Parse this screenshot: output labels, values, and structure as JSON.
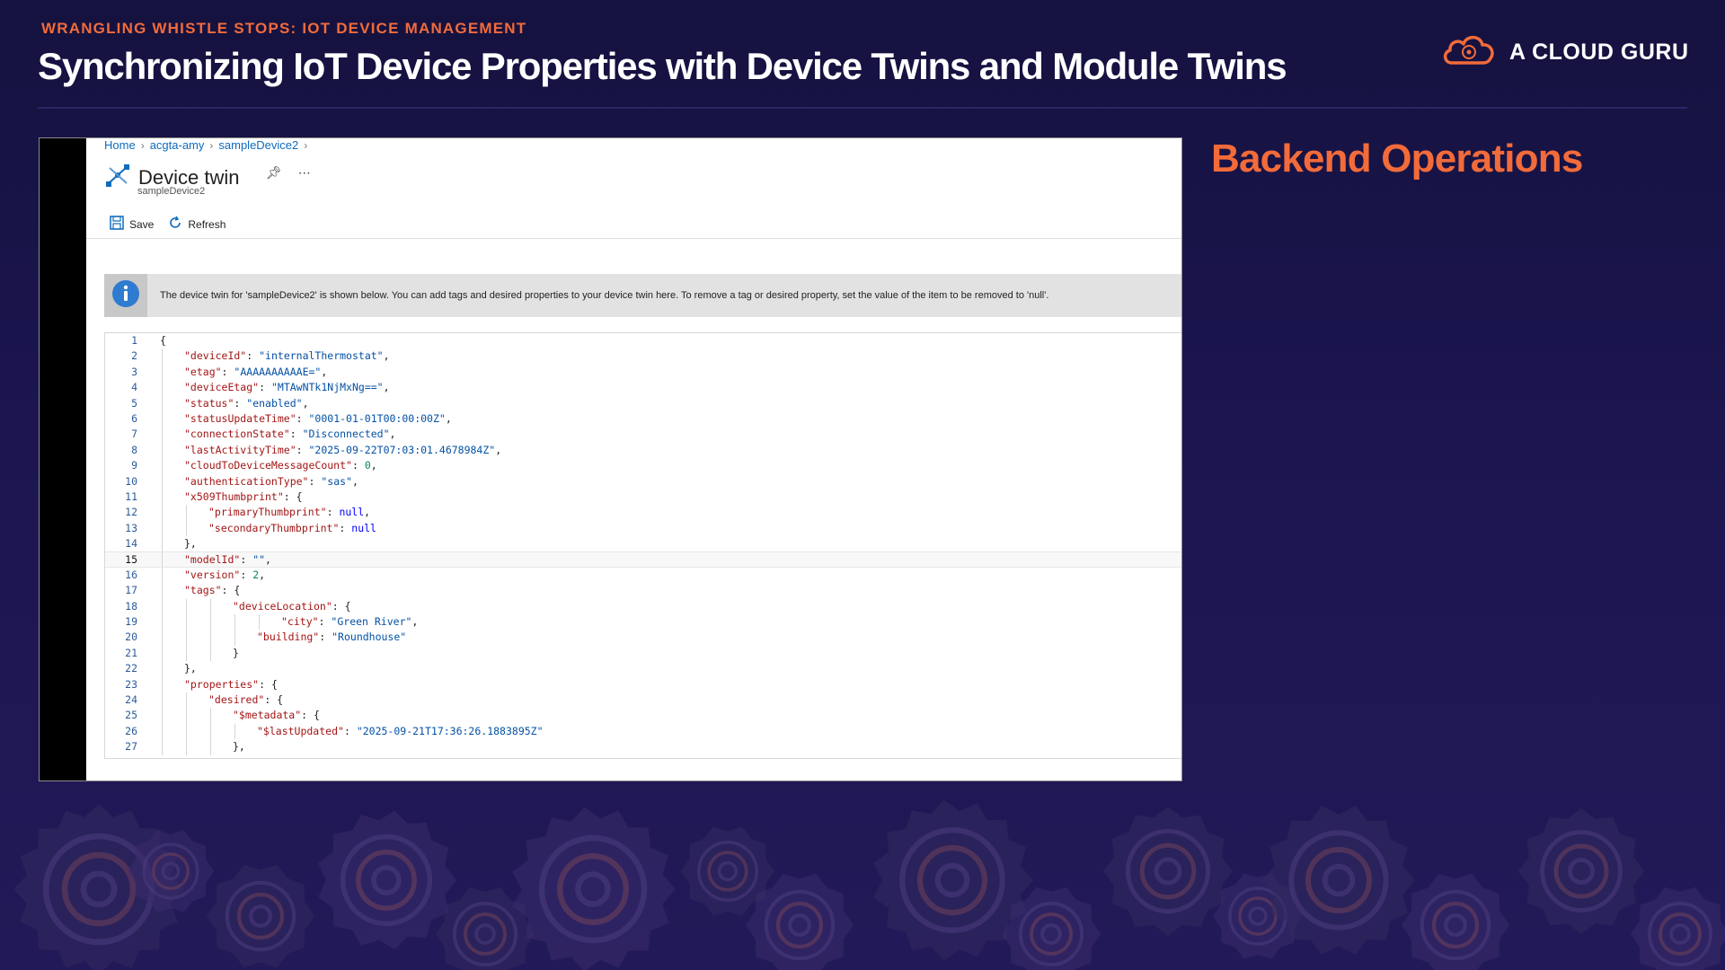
{
  "slide": {
    "eyebrow": "WRANGLING WHISTLE STOPS: IOT DEVICE MANAGEMENT",
    "title": "Synchronizing IoT Device Properties with Device Twins and Module Twins",
    "brand": "A CLOUD GURU",
    "side_heading": "Backend Operations"
  },
  "portal": {
    "breadcrumb": [
      "Home",
      "acgta-amy",
      "sampleDevice2"
    ],
    "page_title": "Device twin",
    "page_subtitle": "sampleDevice2",
    "toolbar": {
      "save_label": "Save",
      "refresh_label": "Refresh"
    },
    "info_text": "The device twin for 'sampleDevice2' is shown below. You can add tags and desired properties to your device twin here. To remove a tag or desired property, set the value of the item to be removed to 'null'.",
    "active_line": 15,
    "code_lines": [
      {
        "n": "1",
        "indent": 0,
        "text": "{"
      },
      {
        "n": "2",
        "indent": 1,
        "text": "\"deviceId\": \"internalThermostat\","
      },
      {
        "n": "3",
        "indent": 1,
        "text": "\"etag\": \"AAAAAAAAAAE=\","
      },
      {
        "n": "4",
        "indent": 1,
        "text": "\"deviceEtag\": \"MTAwNTk1NjMxNg==\","
      },
      {
        "n": "5",
        "indent": 1,
        "text": "\"status\": \"enabled\","
      },
      {
        "n": "6",
        "indent": 1,
        "text": "\"statusUpdateTime\": \"0001-01-01T00:00:00Z\","
      },
      {
        "n": "7",
        "indent": 1,
        "text": "\"connectionState\": \"Disconnected\","
      },
      {
        "n": "8",
        "indent": 1,
        "text": "\"lastActivityTime\": \"2025-09-22T07:03:01.4678984Z\","
      },
      {
        "n": "9",
        "indent": 1,
        "text": "\"cloudToDeviceMessageCount\": 0,"
      },
      {
        "n": "10",
        "indent": 1,
        "text": "\"authenticationType\": \"sas\","
      },
      {
        "n": "11",
        "indent": 1,
        "text": "\"x509Thumbprint\": {"
      },
      {
        "n": "12",
        "indent": 2,
        "text": "\"primaryThumbprint\": null,"
      },
      {
        "n": "13",
        "indent": 2,
        "text": "\"secondaryThumbprint\": null"
      },
      {
        "n": "14",
        "indent": 1,
        "text": "},"
      },
      {
        "n": "15",
        "indent": 1,
        "text": "\"modelId\": \"\","
      },
      {
        "n": "16",
        "indent": 1,
        "text": "\"version\": 2,"
      },
      {
        "n": "17",
        "indent": 1,
        "text": "\"tags\": {"
      },
      {
        "n": "18",
        "indent": 3,
        "text": "\"deviceLocation\": {"
      },
      {
        "n": "19",
        "indent": 5,
        "text": "\"city\": \"Green River\","
      },
      {
        "n": "20",
        "indent": 4,
        "text": "\"building\": \"Roundhouse\""
      },
      {
        "n": "21",
        "indent": 3,
        "text": "}"
      },
      {
        "n": "22",
        "indent": 1,
        "text": "},"
      },
      {
        "n": "23",
        "indent": 1,
        "text": "\"properties\": {"
      },
      {
        "n": "24",
        "indent": 2,
        "text": "\"desired\": {"
      },
      {
        "n": "25",
        "indent": 3,
        "text": "\"$metadata\": {"
      },
      {
        "n": "26",
        "indent": 4,
        "text": "\"$lastUpdated\": \"2025-09-21T17:36:26.1883895Z\""
      },
      {
        "n": "27",
        "indent": 3,
        "text": "},"
      }
    ]
  },
  "colors": {
    "accent": "#f26b3a",
    "background": "#1c1550",
    "link": "#0f6cbd"
  }
}
